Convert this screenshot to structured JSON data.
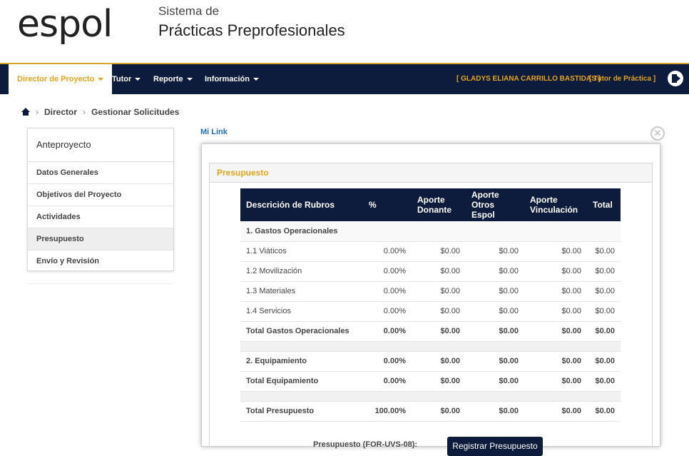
{
  "header": {
    "logo": "espol",
    "system_line1": "Sistema de",
    "system_line2": "Prácticas Preprofesionales"
  },
  "nav": {
    "items": [
      "Director de Proyecto",
      "Tutor",
      "Reporte",
      "Información"
    ],
    "user": "[ GLADYS ELIANA CARRILLO BASTIDAS ]",
    "role": "[ Tutor de Práctica ]",
    "colors": {
      "bar": "#0d1b3d",
      "accent": "#e2a51c"
    }
  },
  "breadcrumb": [
    "Director",
    "Gestionar Solicitudes"
  ],
  "sidebar": {
    "title": "Anteproyecto",
    "items": [
      "Datos Generales",
      "Objetivos del Proyecto",
      "Actividades",
      "Presupuesto",
      "Envío y Revisión"
    ],
    "active": "Presupuesto"
  },
  "main": {
    "link": "Mi Link",
    "close": "✕"
  },
  "panel": {
    "title": "Presupuesto",
    "headers": [
      "Descrición de Rubros",
      "%",
      "Aporte Donante",
      "Aporte Otros Espol",
      "Aporte Vinculación",
      "Total"
    ],
    "rows": [
      {
        "label": "1. Gastos Operacionales",
        "pct": "",
        "donante": "",
        "otros": "",
        "vinc": "",
        "total": ""
      },
      {
        "label": "1.1 Viáticos",
        "pct": "0.00%",
        "donante": "$0.00",
        "otros": "$0.00",
        "vinc": "$0.00",
        "total": "$0.00"
      },
      {
        "label": "1.2 Movilización",
        "pct": "0.00%",
        "donante": "$0.00",
        "otros": "$0.00",
        "vinc": "$0.00",
        "total": "$0.00"
      },
      {
        "label": "1.3 Materiales",
        "pct": "0.00%",
        "donante": "$0.00",
        "otros": "$0.00",
        "vinc": "$0.00",
        "total": "$0.00"
      },
      {
        "label": "1.4 Servicios",
        "pct": "0.00%",
        "donante": "$0.00",
        "otros": "$0.00",
        "vinc": "$0.00",
        "total": "$0.00"
      },
      {
        "label": "Total Gastos Operacionales",
        "pct": "0.00%",
        "donante": "$0.00",
        "otros": "$0.00",
        "vinc": "$0.00",
        "total": "$0.00"
      },
      {
        "label": "2. Equipamiento",
        "pct": "0.00%",
        "donante": "$0.00",
        "otros": "$0.00",
        "vinc": "$0.00",
        "total": "$0.00"
      },
      {
        "label": "Total Equipamiento",
        "pct": "0.00%",
        "donante": "$0.00",
        "otros": "$0.00",
        "vinc": "$0.00",
        "total": "$0.00"
      },
      {
        "label": "Total Presupuesto",
        "pct": "100.00%",
        "donante": "$0.00",
        "otros": "$0.00",
        "vinc": "$0.00",
        "total": "$0.00"
      }
    ],
    "footer_label": "Presupuesto (FOR-UVS-08):",
    "register_button": "Registrar Presupuesto"
  }
}
